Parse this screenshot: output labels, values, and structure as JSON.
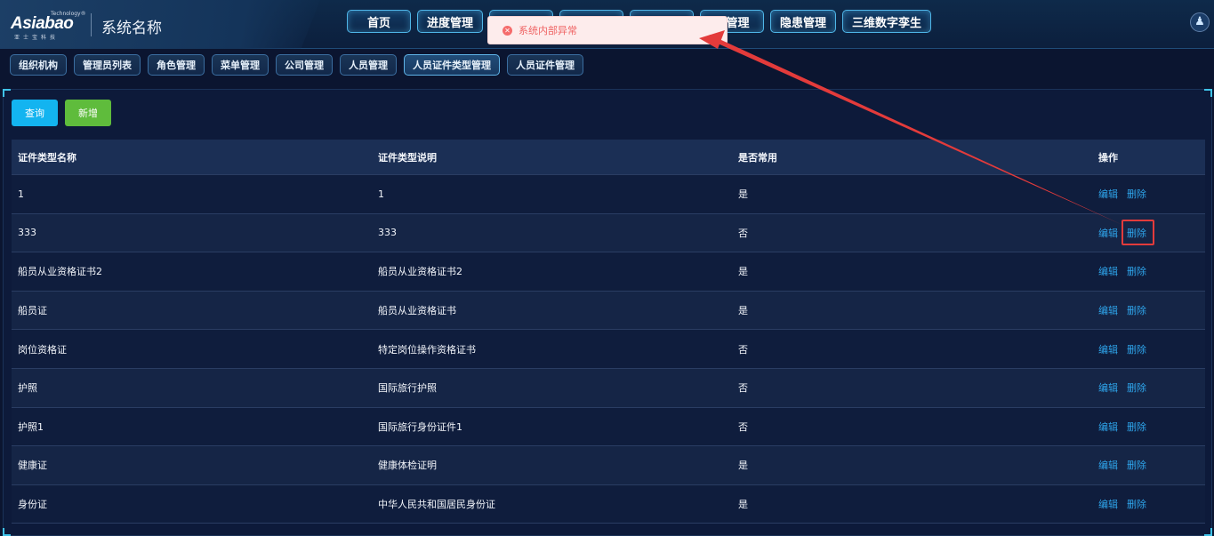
{
  "header": {
    "logo": {
      "brand": "Asiabao",
      "tech": "Technology®",
      "sub": "亚士宝科技"
    },
    "system_name": "系统名称",
    "top_nav": [
      {
        "label": "首页"
      },
      {
        "label": "进度管理"
      },
      {
        "label": ""
      },
      {
        "label": ""
      },
      {
        "label": ""
      },
      {
        "label": "训管理"
      },
      {
        "label": "隐患管理"
      },
      {
        "label": "三维数字孪生"
      }
    ],
    "user_icon": "user-icon"
  },
  "sub_nav": [
    {
      "label": "组织机构"
    },
    {
      "label": "管理员列表"
    },
    {
      "label": "角色管理"
    },
    {
      "label": "菜单管理"
    },
    {
      "label": "公司管理"
    },
    {
      "label": "人员管理"
    },
    {
      "label": "人员证件类型管理",
      "active": true
    },
    {
      "label": "人员证件管理"
    }
  ],
  "toolbar": {
    "query_label": "查询",
    "add_label": "新增"
  },
  "table": {
    "columns": [
      "证件类型名称",
      "证件类型说明",
      "是否常用",
      "操作"
    ],
    "rows": [
      {
        "name": "1",
        "desc": "1",
        "common": "是"
      },
      {
        "name": "333",
        "desc": "333",
        "common": "否"
      },
      {
        "name": "船员从业资格证书2",
        "desc": "船员从业资格证书2",
        "common": "是"
      },
      {
        "name": "船员证",
        "desc": "船员从业资格证书",
        "common": "是"
      },
      {
        "name": "岗位资格证",
        "desc": "特定岗位操作资格证书",
        "common": "否"
      },
      {
        "name": "护照",
        "desc": "国际旅行护照",
        "common": "否"
      },
      {
        "name": "护照1",
        "desc": "国际旅行身份证件1",
        "common": "否"
      },
      {
        "name": "健康证",
        "desc": "健康体检证明",
        "common": "是"
      },
      {
        "name": "身份证",
        "desc": "中华人民共和国居民身份证",
        "common": "是"
      }
    ],
    "edit_label": "编辑",
    "delete_label": "删除"
  },
  "toast": {
    "message": "系统内部异常",
    "type": "error"
  },
  "colors": {
    "accent": "#13b4f0",
    "add": "#5fbc3c",
    "link": "#2ea4ea",
    "error": "#ef6363",
    "annotation": "#e33b3b"
  }
}
